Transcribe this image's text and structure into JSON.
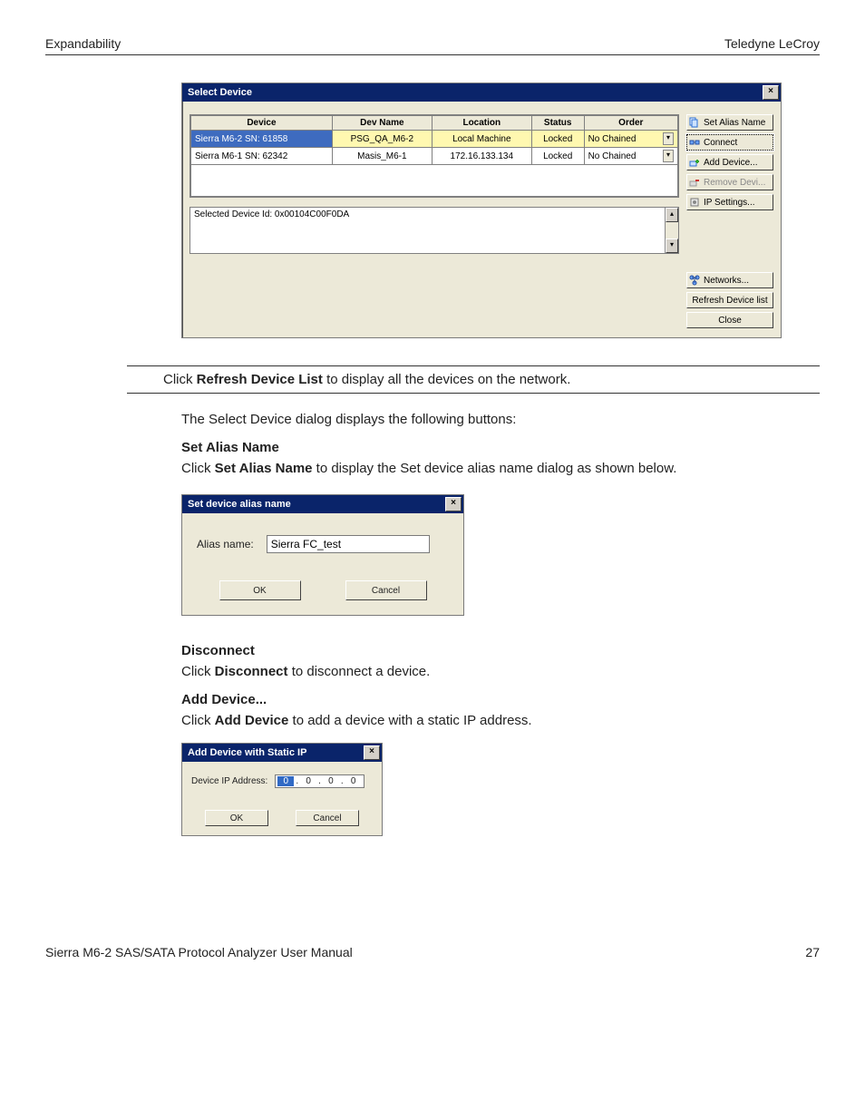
{
  "header": {
    "left": "Expandability",
    "right": "Teledyne LeCroy"
  },
  "footer": {
    "left": "Sierra M6-2 SAS/SATA Protocol Analyzer User Manual",
    "right": "27"
  },
  "select_device": {
    "title": "Select Device",
    "columns": [
      "Device",
      "Dev Name",
      "Location",
      "Status",
      "Order"
    ],
    "rows": [
      {
        "device": "Sierra M6-2  SN: 61858",
        "dev_name": "PSG_QA_M6-2",
        "location": "Local Machine",
        "status": "Locked",
        "order": "No Chained",
        "selected": true
      },
      {
        "device": "Sierra M6-1  SN: 62342",
        "dev_name": "Masis_M6-1",
        "location": "172.16.133.134",
        "status": "Locked",
        "order": "No Chained",
        "selected": false
      }
    ],
    "selected_label": "Selected Device Id: 0x00104C00F0DA",
    "buttons": {
      "set_alias": "Set Alias Name",
      "connect": "Connect",
      "add_device": "Add Device...",
      "remove_device": "Remove Devi...",
      "ip_settings": "IP Settings...",
      "networks": "Networks...",
      "refresh": "Refresh Device list",
      "close": "Close"
    }
  },
  "instruction_bar": {
    "pre": "Click ",
    "bold": "Refresh Device List",
    "post": " to display all the devices on the network."
  },
  "intro": "The Select Device dialog displays the following buttons:",
  "set_alias": {
    "heading": "Set Alias Name",
    "body_pre": "Click ",
    "body_bold": "Set Alias Name",
    "body_post": " to display the Set device alias name dialog as shown below.",
    "dialog_title": "Set device alias name",
    "label": "Alias name:",
    "value": "Sierra FC_test",
    "ok": "OK",
    "cancel": "Cancel"
  },
  "disconnect": {
    "heading": "Disconnect",
    "body_pre": "Click ",
    "body_bold": "Disconnect",
    "body_post": " to disconnect a device."
  },
  "add_device": {
    "heading": "Add Device...",
    "body_pre": "Click ",
    "body_bold": "Add Device",
    "body_post": " to add a device with a static IP address.",
    "dialog_title": "Add Device with Static IP",
    "label": "Device IP Address:",
    "octets": [
      "0",
      "0",
      "0",
      "0"
    ],
    "ok": "OK",
    "cancel": "Cancel"
  }
}
